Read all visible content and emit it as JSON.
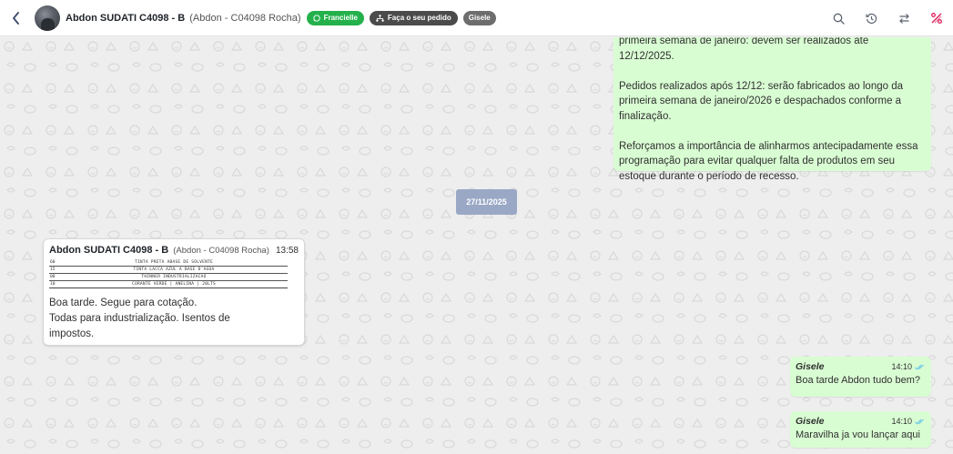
{
  "header": {
    "contact_name": "Abdon SUDATI C4098 - B",
    "contact_sub": "(Abdon - C04098 Rocha)",
    "tags": [
      {
        "label": "Francielle",
        "icon": "whatsapp-icon",
        "color": "#24b14c"
      },
      {
        "label": "Faça o seu pedido",
        "icon": "flow-icon",
        "color": "#4b4b4b"
      },
      {
        "label": "Gisele",
        "color": "#6d6d6d"
      }
    ],
    "actions": [
      "search-icon",
      "history-icon",
      "transfer-icon",
      "close-conversation-icon"
    ]
  },
  "announcement": {
    "paragraphs": [
      "primeira semana de janeiro: devem ser realizados até 12/12/2025.",
      "Pedidos realizados após 12/12: serão fabricados ao longo da primeira semana de janeiro/2026 e despachados conforme a finalização.",
      "Reforçamos a importância de alinharmos antecipadamente essa programação para evitar qualquer falta de produtos em seu estoque durante o período de recesso."
    ]
  },
  "date_separator": "27/11/2025",
  "incoming": {
    "sender": "Abdon SUDATI C4098 - B",
    "sender_sub": "(Abdon - C04098 Rocha)",
    "time": "13:58",
    "document_rows": [
      {
        "qty": "60",
        "desc": "TINTA PRETA ABASE DE SOLVENTE"
      },
      {
        "qty": "15",
        "desc": "TINTA LACCA AZUL A BASE D'AGUA"
      },
      {
        "qty": "08",
        "desc": "THINNER INDUSTRIALIZACAO"
      },
      {
        "qty": "10",
        "desc": "CORANTE VERDE | ANELINA | 20LTS"
      }
    ],
    "lines": [
      "Boa tarde. Segue para cotação.",
      "Todas para industrialização. Isentos de",
      "impostos."
    ]
  },
  "outgoing": [
    {
      "sender": "Gisele",
      "time": "14:10",
      "text": "Boa tarde Abdon tudo bem?"
    },
    {
      "sender": "Gisele",
      "time": "14:10",
      "text": "Maravilha ja vou lançar aqui"
    }
  ],
  "colors": {
    "outgoing_bubble": "#d9fdd3",
    "incoming_bubble": "#ffffff",
    "date_chip": "#9aa8c6",
    "read_ticks": "#53bdeb",
    "danger_icon": "#e0245e"
  }
}
